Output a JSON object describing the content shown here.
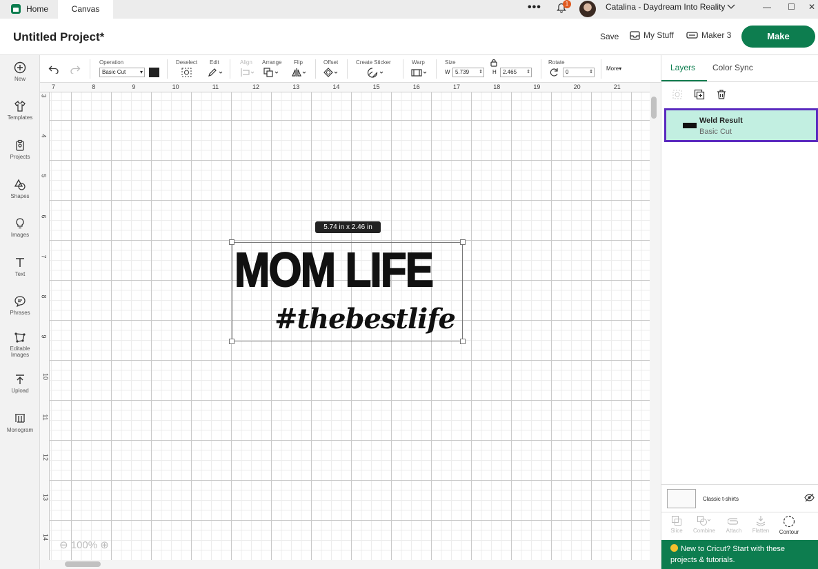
{
  "window": {
    "tabs": [
      {
        "label": "Home"
      },
      {
        "label": "Canvas"
      }
    ],
    "notification_count": "1",
    "user_name": "Catalina - Daydream Into Reality"
  },
  "header": {
    "project_title": "Untitled Project*",
    "save_label": "Save",
    "my_stuff_label": "My Stuff",
    "machine_label": "Maker 3",
    "make_label": "Make"
  },
  "sidebar": {
    "items": [
      {
        "label": "New",
        "icon": "plus-circle-icon"
      },
      {
        "label": "Templates",
        "icon": "shirt-icon"
      },
      {
        "label": "Projects",
        "icon": "clipboard-icon"
      },
      {
        "label": "Shapes",
        "icon": "shapes-icon"
      },
      {
        "label": "Images",
        "icon": "lightbulb-icon"
      },
      {
        "label": "Text",
        "icon": "text-icon"
      },
      {
        "label": "Phrases",
        "icon": "speech-bubble-icon"
      },
      {
        "label": "Editable",
        "label2": "Images",
        "icon": "editable-images-icon"
      },
      {
        "label": "Upload",
        "icon": "upload-icon"
      },
      {
        "label": "Monogram",
        "icon": "monogram-icon"
      }
    ]
  },
  "toolbar": {
    "operation_label": "Operation",
    "operation_value": "Basic Cut",
    "operation_color": "#222222",
    "deselect_label": "Deselect",
    "edit_label": "Edit",
    "align_label": "Align",
    "arrange_label": "Arrange",
    "flip_label": "Flip",
    "offset_label": "Offset",
    "create_sticker_label": "Create Sticker",
    "warp_label": "Warp",
    "size_label": "Size",
    "width_prefix": "W",
    "width_value": "5.739",
    "height_prefix": "H",
    "height_value": "2.465",
    "rotate_label": "Rotate",
    "rotate_value": "0",
    "more_label": "More▾"
  },
  "rulers": {
    "top": [
      "7",
      "8",
      "9",
      "10",
      "11",
      "12",
      "13",
      "14",
      "15",
      "16",
      "17",
      "18",
      "19",
      "20",
      "21"
    ],
    "left": [
      "3",
      "4",
      "5",
      "6",
      "7",
      "8",
      "9",
      "10",
      "11",
      "12",
      "13",
      "14"
    ]
  },
  "canvas": {
    "dimension_tooltip": "5.74  in x 2.46  in",
    "design_line1": "MOM LIFE",
    "design_line2": "#thebestlife",
    "zoom_label": "100%"
  },
  "right_panel": {
    "tabs": [
      {
        "label": "Layers"
      },
      {
        "label": "Color Sync"
      }
    ],
    "layer": {
      "name": "Weld Result",
      "operation": "Basic Cut",
      "highlight_color": "#c2efe1",
      "border_color": "#5b2bbf"
    },
    "canvas_row_label": "Classic t-shirts",
    "bottom_tools": [
      {
        "label": "Slice",
        "icon": "slice-icon"
      },
      {
        "label": "Combine",
        "icon": "combine-icon"
      },
      {
        "label": "Attach",
        "icon": "attach-icon"
      },
      {
        "label": "Flatten",
        "icon": "flatten-icon"
      },
      {
        "label": "Contour",
        "icon": "contour-icon"
      }
    ],
    "promo_text": "New to Cricut? Start with these projects & tutorials."
  },
  "colors": {
    "brand": "#0d7d4f"
  }
}
